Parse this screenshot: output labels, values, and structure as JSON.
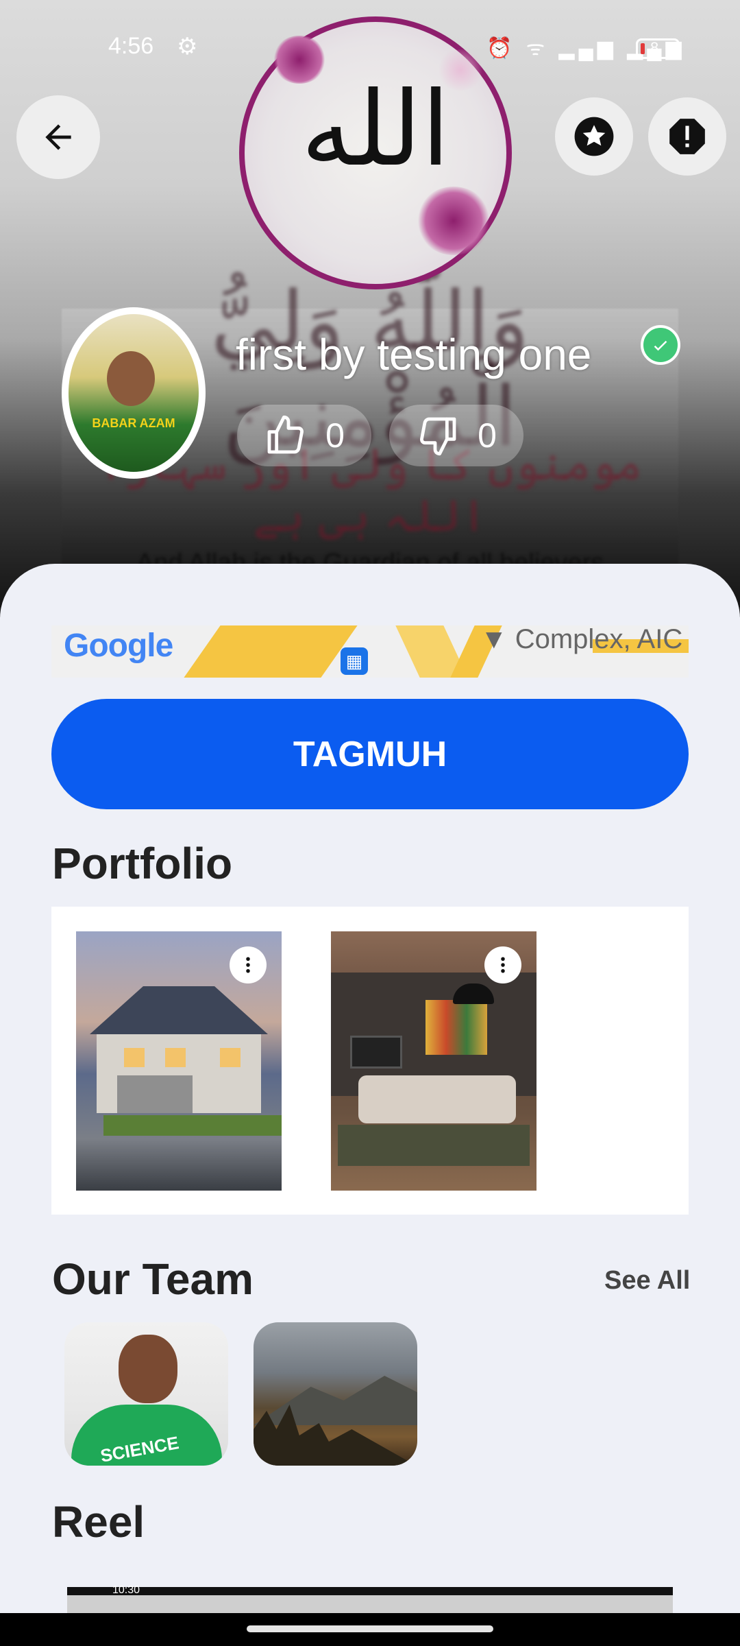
{
  "status_bar": {
    "time": "4:56",
    "battery": "8"
  },
  "header": {
    "medallion_text": "الله",
    "banner": {
      "arabic": "وَاللّٰهُ وَلِيُّ الْمُؤْمِنِينَ",
      "urdu": "مومنوں کا ولی اور سہارا اللہ ہی ہے",
      "english": "And Allah is the Guardian of all believers"
    }
  },
  "profile": {
    "title": "first by testing one",
    "avatar_caption": "BABAR AZAM",
    "likes": "0",
    "dislikes": "0"
  },
  "map": {
    "logo": "Google",
    "label": "Complex, AIC"
  },
  "primary_button": {
    "label": "TAGMUH"
  },
  "portfolio": {
    "title": "Portfolio"
  },
  "team": {
    "title": "Our Team",
    "see_all": "See All",
    "shirt_text": "SCIENCE"
  },
  "reel": {
    "title": "Reel",
    "thumb_time": "10:30"
  },
  "colors": {
    "primary": "#0b5cf0",
    "verified": "#3fc777",
    "sheet_bg": "#eef0f7"
  },
  "icons": {
    "back": "arrow-left-icon",
    "favorite": "star-icon",
    "report": "alert-icon",
    "like": "thumbs-up-icon",
    "dislike": "thumbs-down-icon",
    "more": "more-vertical-icon"
  }
}
